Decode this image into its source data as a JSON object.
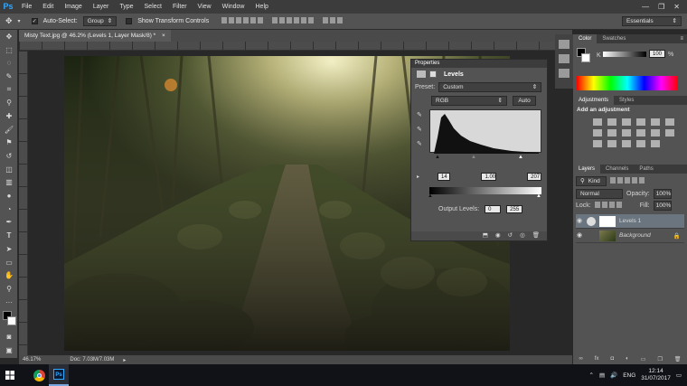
{
  "app": {
    "logo": "Ps"
  },
  "menu": [
    "File",
    "Edit",
    "Image",
    "Layer",
    "Type",
    "Select",
    "Filter",
    "View",
    "Window",
    "Help"
  ],
  "window_controls": [
    "—",
    "❐",
    "✕"
  ],
  "options": {
    "auto_select_label": "Auto-Select:",
    "auto_select_value": "Group",
    "transform_label": "Show Transform Controls",
    "workspace": "Essentials"
  },
  "document": {
    "tab_title": "Misty Text.jpg @ 46.2% (Levels 1, Layer Mask/8) *",
    "tab_close": "×"
  },
  "status": {
    "zoom": "46.17%",
    "doc": "Doc: 7.03M/7.03M"
  },
  "color_panel": {
    "tabs": [
      "Color",
      "Swatches"
    ],
    "channel": "K",
    "value": "100",
    "unit": "%"
  },
  "adjustments_panel": {
    "tabs": [
      "Adjustments",
      "Styles"
    ],
    "heading": "Add an adjustment"
  },
  "layers_panel": {
    "tabs": [
      "Layers",
      "Channels",
      "Paths"
    ],
    "filter": "Kind",
    "blend": "Normal",
    "opacity_label": "Opacity:",
    "opacity": "100%",
    "lock_label": "Lock:",
    "fill_label": "Fill:",
    "fill": "100%",
    "layers": [
      {
        "name": "Levels 1"
      },
      {
        "name": "Background"
      }
    ]
  },
  "properties_panel": {
    "title": "Properties",
    "type": "Levels",
    "preset_label": "Preset:",
    "preset": "Custom",
    "channel": "RGB",
    "auto_label": "Auto",
    "input_black": "14",
    "input_gamma": "1.00",
    "input_white": "207",
    "output_label": "Output Levels:",
    "output_black": "0",
    "output_white": "255"
  },
  "taskbar": {
    "language": "ENG",
    "time": "12:14",
    "date": "31/07/2017"
  },
  "colors": {
    "accent": "#31a8ff",
    "panel": "#535353",
    "dark": "#282828"
  }
}
